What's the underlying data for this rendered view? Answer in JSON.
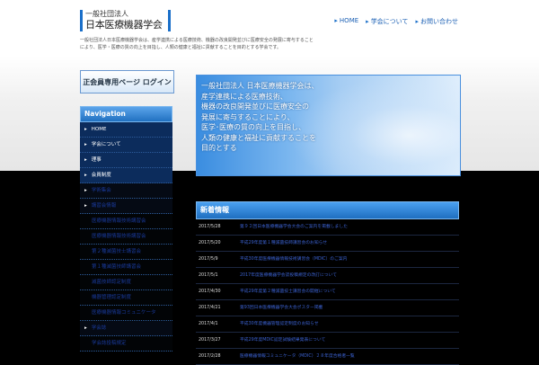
{
  "header": {
    "logo_line1": "一般社団法人",
    "logo_line2": "日本医療機器学会",
    "nav": [
      "HOME",
      "学会について",
      "お問い合わせ"
    ]
  },
  "intro": "一般社団法人日本医療機器学会は、産学連携による医療技術、機器の改良開発並びに医療安全の発展に寄与することにより、医学・医療の質の向上を目指し、人類の健康と福祉に貢献することを目的とする学会です。",
  "login": {
    "label": "正会員専用ページ ログイン"
  },
  "sidenav": {
    "header": "Navigation",
    "items": [
      {
        "label": "HOME",
        "style": ""
      },
      {
        "label": "学会について",
        "style": ""
      },
      {
        "label": "理事",
        "style": ""
      },
      {
        "label": "会員制度",
        "style": ""
      },
      {
        "label": "学術集会",
        "style": "dark"
      },
      {
        "label": "講習会情報",
        "style": "dark"
      },
      {
        "label": "医療機器情報技術講習会",
        "style": "sub"
      },
      {
        "label": "医療機器情報技術講習会",
        "style": "sub"
      },
      {
        "label": "第２種滅菌技士講習会",
        "style": "sub"
      },
      {
        "label": "第１種滅菌技師講習会",
        "style": "sub"
      },
      {
        "label": "滅菌技師認定制度",
        "style": "sub"
      },
      {
        "label": "機器管理認定制度",
        "style": "sub"
      },
      {
        "label": "医療機器情報コミュニケータ",
        "style": "sub"
      },
      {
        "label": "学会誌",
        "style": "dark"
      },
      {
        "label": "学会誌投稿規定",
        "style": "sub"
      }
    ]
  },
  "hero": {
    "lines": [
      "一般社団法人 日本医療機器学会は、",
      "産学連携による医療技術、",
      "機器の改良開発並びに医療安全の",
      "発展に寄与することにより、",
      "医学･医療の質の向上を目指し、",
      "人類の健康と福祉に貢献することを",
      "目的とする"
    ]
  },
  "news": {
    "header": "新着情報",
    "rows": [
      {
        "date": "2017/5/28",
        "title": "第９２回日本医療機器学会大会のご案内を掲載しました"
      },
      {
        "date": "2017/5/20",
        "title": "平成29年度第１種滅菌技師講習会のお知らせ"
      },
      {
        "date": "2017/5/9",
        "title": "平成30年度医療機器情報技術講習会（MDIC）のご案内"
      },
      {
        "date": "2017/5/1",
        "title": "2017年度医療機器学会誌投稿規定の改訂について"
      },
      {
        "date": "2017/4/30",
        "title": "平成29年度第２種滅菌技士講習会の開催について"
      },
      {
        "date": "2017/4/21",
        "title": "第93回日本医療機器学会大会ポスター掲載"
      },
      {
        "date": "2017/4/1",
        "title": "平成30年度機器管理認定制度のお知らせ"
      },
      {
        "date": "2017/3/27",
        "title": "平成29年度MDIC認定試験結果発表について"
      },
      {
        "date": "2017/2/28",
        "title": "医療機器情報コミュニケータ（MDIC）２８年度合格者一覧"
      }
    ]
  }
}
